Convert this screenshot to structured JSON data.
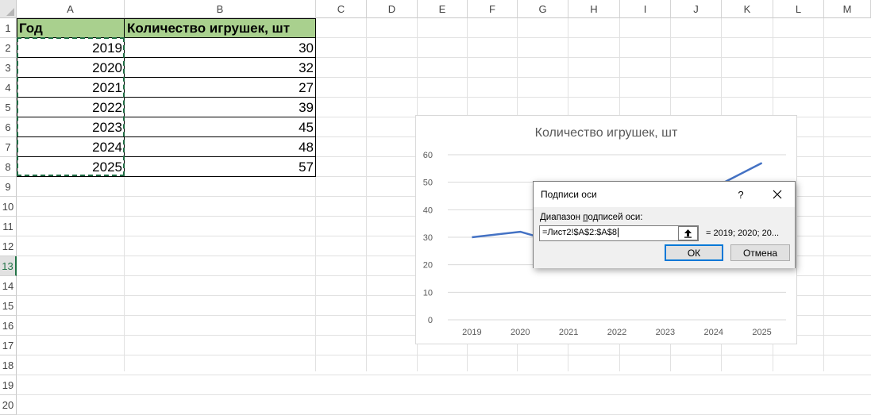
{
  "columns": [
    "A",
    "B",
    "C",
    "D",
    "E",
    "F",
    "G",
    "H",
    "I",
    "J",
    "K",
    "L",
    "M"
  ],
  "rows": [
    "1",
    "2",
    "3",
    "4",
    "5",
    "6",
    "7",
    "8",
    "9",
    "10",
    "11",
    "12",
    "13",
    "14",
    "15",
    "16",
    "17",
    "18",
    "19",
    "20"
  ],
  "active_row": "13",
  "table": {
    "headers": [
      "Год",
      "Количество игрушек, шт"
    ],
    "rows": [
      {
        "year": "2019",
        "count": "30"
      },
      {
        "year": "2020",
        "count": "32"
      },
      {
        "year": "2021",
        "count": "27"
      },
      {
        "year": "2022",
        "count": "39"
      },
      {
        "year": "2023",
        "count": "45"
      },
      {
        "year": "2024",
        "count": "48"
      },
      {
        "year": "2025",
        "count": "57"
      }
    ]
  },
  "colors": {
    "header_fill": "#a9d08e",
    "line": "#4472c4",
    "selection": "#1f6b43",
    "ok_border": "#0078d7"
  },
  "chart_data": {
    "type": "line",
    "title": "Количество игрушек, шт",
    "categories": [
      "2019",
      "2020",
      "2021",
      "2022",
      "2023",
      "2024",
      "2025"
    ],
    "series": [
      {
        "values": [
          30,
          32,
          27,
          39,
          45,
          48,
          57
        ]
      }
    ],
    "yticks": [
      "0",
      "10",
      "20",
      "30",
      "40",
      "50",
      "60"
    ],
    "ylim": [
      0,
      60
    ],
    "grid": true,
    "legend": "none"
  },
  "dialog": {
    "title": "Подписи оси",
    "help": "?",
    "label_pre": "Диапазон ",
    "label_underlined": "п",
    "label_post": "одписей оси:",
    "input_value": "=Лист2!$A$2:$A$8",
    "preview": "= 2019; 2020; 20...",
    "ok_label": "ОК",
    "cancel_label": "Отмена",
    "close_icon": "close-icon",
    "collapse_icon": "collapse-dialog-icon"
  }
}
